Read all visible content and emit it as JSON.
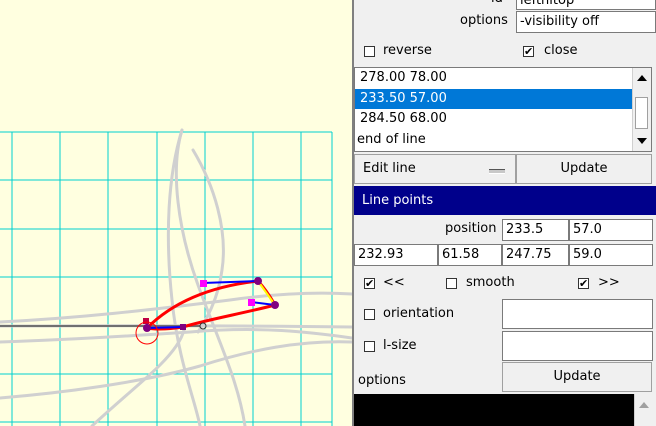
{
  "form": {
    "id_label": "id",
    "id_value": "leftnltop",
    "options_label": "options",
    "options_value": "-visibility off",
    "reverse_label": "reverse",
    "reverse_checked": false,
    "close_label": "close",
    "close_checked": true
  },
  "point_list": {
    "items": [
      "278.00  78.00",
      "233.50  57.00",
      "284.50  68.00",
      "end of line"
    ],
    "selected_index": 1
  },
  "edit_row": {
    "dropdown_value": "Edit line",
    "update_label": "Update"
  },
  "line_points": {
    "title": "Line points",
    "position_label": "position",
    "position_x": "233.5",
    "position_y": "57.0",
    "handle_in_x": "232.93",
    "handle_in_y": "61.58",
    "handle_out_x": "247.75",
    "handle_out_y": "59.0",
    "prev_label": "<<",
    "prev_checked": true,
    "smooth_label": "smooth",
    "smooth_checked": false,
    "next_label": ">>",
    "next_checked": true,
    "orientation_label": "orientation",
    "orientation_checked": false,
    "orientation_value": "",
    "lsize_label": "l-size",
    "lsize_checked": false,
    "lsize_value": "",
    "options_label": "options",
    "update_label": "Update"
  },
  "colors": {
    "canvas_bg": "#ffffe0",
    "grid": "#00d0d0",
    "selected_line": "#ff0000",
    "control_point": "#800080",
    "handle_point": "#ff00ff",
    "banner": "#00008b",
    "list_selection": "#0078d7"
  },
  "icons": {
    "check": "✔",
    "scroll_up": "up-arrow",
    "scroll_down": "down-arrow",
    "dropdown": "dash"
  }
}
